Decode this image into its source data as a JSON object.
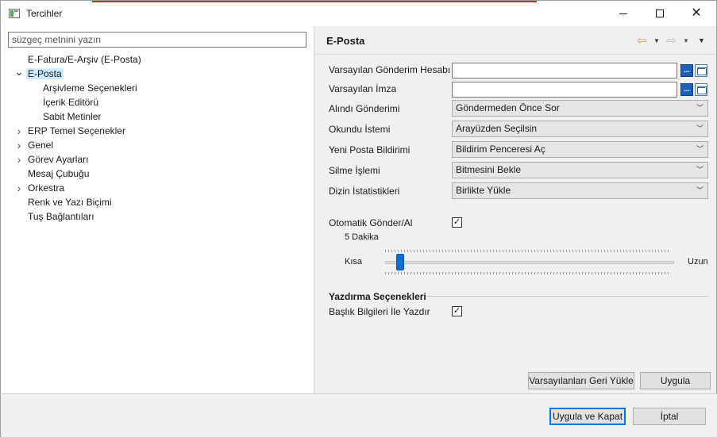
{
  "window": {
    "title": "Tercihler"
  },
  "left": {
    "filter_placeholder": "süzgeç metnini yazın",
    "tree": [
      {
        "label": "E-Fatura/E-Arşiv (E-Posta)",
        "level": 0,
        "twisty": "none"
      },
      {
        "label": "E-Posta",
        "level": 0,
        "twisty": "expanded",
        "selected": true
      },
      {
        "label": "Arşivleme Seçenekleri",
        "level": 1,
        "twisty": "none"
      },
      {
        "label": "İçerik Editörü",
        "level": 1,
        "twisty": "none"
      },
      {
        "label": "Sabit Metinler",
        "level": 1,
        "twisty": "none"
      },
      {
        "label": "ERP Temel Seçenekler",
        "level": 0,
        "twisty": "collapsed"
      },
      {
        "label": "Genel",
        "level": 0,
        "twisty": "collapsed"
      },
      {
        "label": "Görev Ayarları",
        "level": 0,
        "twisty": "collapsed"
      },
      {
        "label": "Mesaj Çubuğu",
        "level": 0,
        "twisty": "none"
      },
      {
        "label": "Orkestra",
        "level": 0,
        "twisty": "collapsed"
      },
      {
        "label": "Renk ve Yazı Biçimi",
        "level": 0,
        "twisty": "none"
      },
      {
        "label": "Tuş Bağlantıları",
        "level": 0,
        "twisty": "none"
      }
    ]
  },
  "page": {
    "title": "E-Posta",
    "fields": {
      "default_account_label": "Varsayılan Gönderim Hesabı",
      "default_account_value": "",
      "default_signature_label": "Varsayılan İmza",
      "default_signature_value": "",
      "browse_label": "...",
      "receipt_label": "Alındı Gönderimi",
      "receipt_value": "Göndermeden Önce Sor",
      "read_request_label": "Okundu İstemi",
      "read_request_value": "Arayüzden Seçilsin",
      "new_mail_label": "Yeni Posta Bildirimi",
      "new_mail_value": "Bildirim Penceresi Aç",
      "delete_label": "Silme İşlemi",
      "delete_value": "Bitmesini Bekle",
      "dir_stats_label": "Dizin İstatistikleri",
      "dir_stats_value": "Birlikte Yükle"
    },
    "auto_send": {
      "label": "Otomatik Gönder/Al",
      "checked": true,
      "check_mark": "✓",
      "interval_text": "5 Dakika",
      "slider_min_label": "Kısa",
      "slider_max_label": "Uzun",
      "slider_fraction": 0.04
    },
    "print": {
      "section_title": "Yazdırma Seçenekleri",
      "header_label": "Başlık Bilgileri İle Yazdır",
      "checked": true,
      "check_mark": "✓"
    },
    "restore_defaults_label": "Varsayılanları Geri Yükle",
    "apply_label": "Uygula"
  },
  "footer": {
    "apply_close_label": "Uygula ve Kapat",
    "cancel_label": "İptal"
  }
}
